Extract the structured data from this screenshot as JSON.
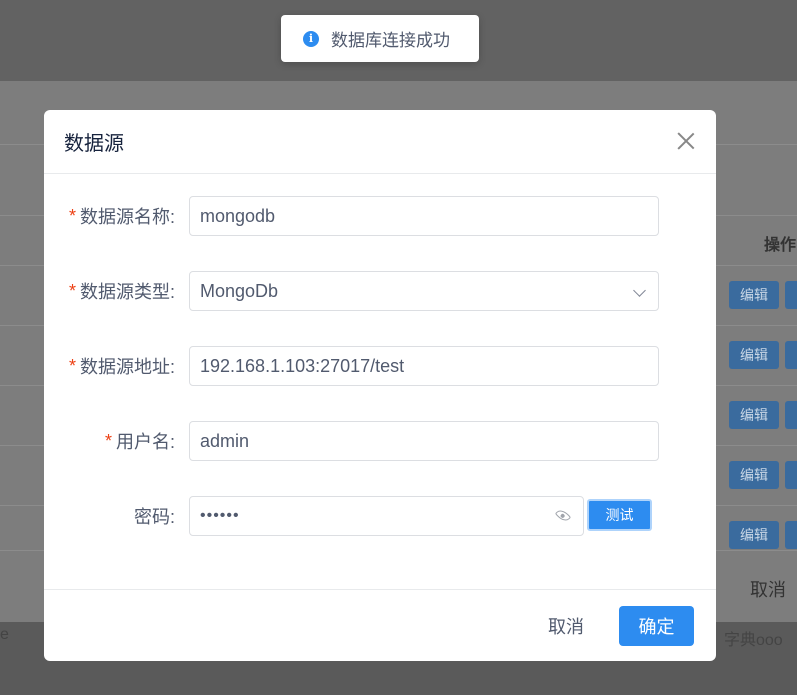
{
  "toast": {
    "message": "数据库连接成功",
    "icon": "info-icon"
  },
  "background": {
    "op_header": "操作",
    "edit_label": "编辑",
    "cancel_label": "取消",
    "dict_text": "字典ooo"
  },
  "modal": {
    "title": "数据源",
    "fields": {
      "name": {
        "label": "数据源名称:",
        "value": "mongodb",
        "required": true
      },
      "type": {
        "label": "数据源类型:",
        "value": "MongoDb",
        "required": true
      },
      "address": {
        "label": "数据源地址:",
        "value": "192.168.1.103:27017/test",
        "required": true
      },
      "username": {
        "label": "用户名:",
        "value": "admin",
        "required": true
      },
      "password": {
        "label": "密码:",
        "value": "••••••",
        "required": false
      }
    },
    "test_button": "测试",
    "cancel_button": "取消",
    "ok_button": "确定"
  },
  "colors": {
    "primary": "#2d8cf0",
    "required": "#ed4014"
  }
}
